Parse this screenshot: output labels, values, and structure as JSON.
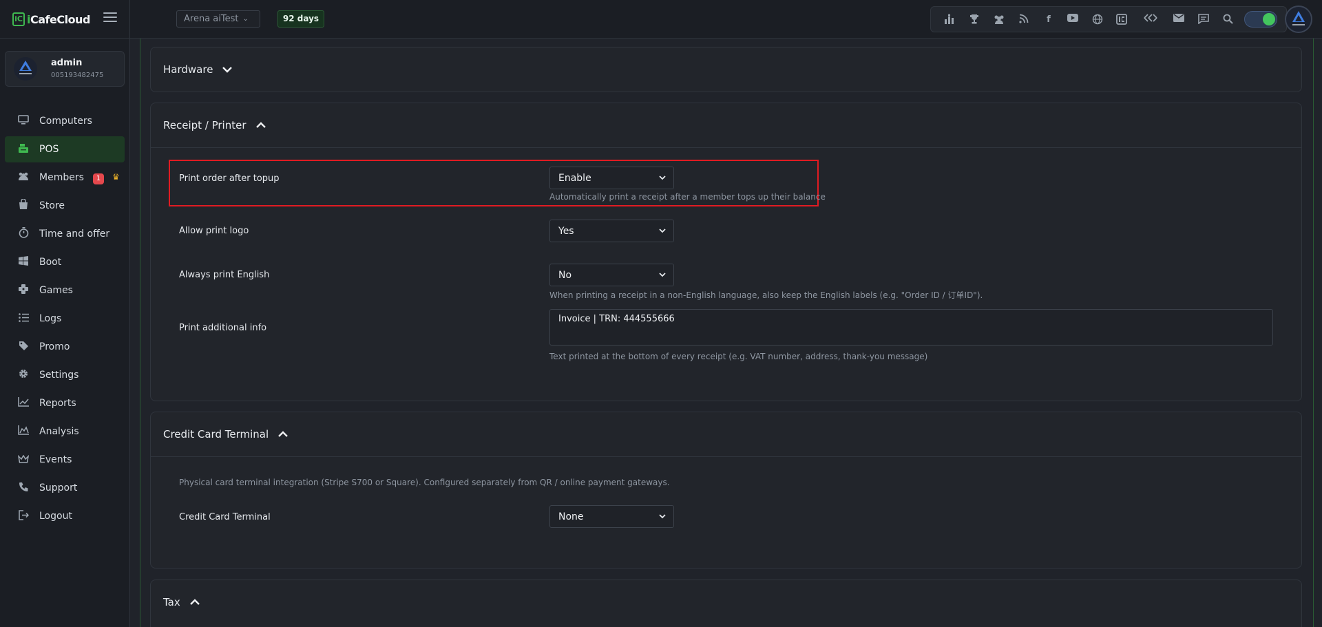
{
  "app": {
    "logo_prefix": "i",
    "logo_rest": "CafeCloud"
  },
  "header": {
    "shop": "Arena aiTest",
    "days_left": "92 days",
    "toolbar_icons": [
      "rank-icon",
      "trophy-icon",
      "group-icon",
      "rss-icon",
      "facebook-icon",
      "youtube-icon",
      "globe-icon",
      "icafe-icon",
      "arrows-icon",
      "mail-icon",
      "chat-icon",
      "search-icon"
    ]
  },
  "user": {
    "name": "admin",
    "id": "005193482475"
  },
  "sidebar": {
    "items": [
      {
        "label": "Computers",
        "icon": "monitor-icon"
      },
      {
        "label": "POS",
        "icon": "register-icon",
        "active": true
      },
      {
        "label": "Members",
        "icon": "users-icon",
        "badge": "1"
      },
      {
        "label": "Store",
        "icon": "bag-icon"
      },
      {
        "label": "Time and offer",
        "icon": "timer-icon"
      },
      {
        "label": "Boot",
        "icon": "windows-icon"
      },
      {
        "label": "Games",
        "icon": "gamepad-icon"
      },
      {
        "label": "Logs",
        "icon": "list-icon"
      },
      {
        "label": "Promo",
        "icon": "tag-icon"
      },
      {
        "label": "Settings",
        "icon": "gear-icon"
      },
      {
        "label": "Reports",
        "icon": "chart-icon"
      },
      {
        "label": "Analysis",
        "icon": "analysis-icon"
      },
      {
        "label": "Events",
        "icon": "crown-icon"
      },
      {
        "label": "Support",
        "icon": "phone-icon"
      },
      {
        "label": "Logout",
        "icon": "logout-icon"
      }
    ]
  },
  "sections": {
    "hardware": {
      "title": "Hardware"
    },
    "receipt": {
      "title": "Receipt / Printer",
      "print_after_topup": {
        "label": "Print order after topup",
        "value": "Enable",
        "hint": "Automatically print a receipt after a member tops up their balance"
      },
      "allow_logo": {
        "label": "Allow print logo",
        "value": "Yes"
      },
      "always_english": {
        "label": "Always print English",
        "value": "No",
        "hint": "When printing a receipt in a non-English language, also keep the English labels (e.g. \"Order ID / 订单ID\")."
      },
      "additional_info": {
        "label": "Print additional info",
        "value": "Invoice  |  TRN: 444555666",
        "hint": "Text printed at the bottom of every receipt (e.g. VAT number, address, thank-you message)"
      }
    },
    "card_terminal": {
      "title": "Credit Card Terminal",
      "description": "Physical card terminal integration (Stripe S700 or Square). Configured separately from QR / online payment gateways.",
      "label": "Credit Card Terminal",
      "value": "None"
    },
    "tax": {
      "title": "Tax"
    }
  },
  "colors": {
    "accent": "#3fb950",
    "highlight": "#e11b22"
  }
}
